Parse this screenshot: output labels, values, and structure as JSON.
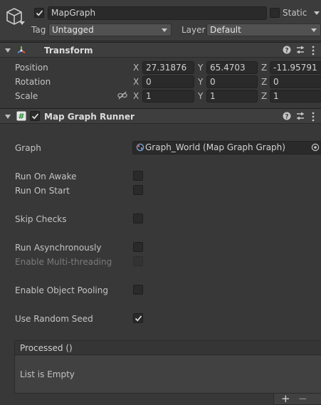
{
  "header": {
    "active": true,
    "object_name": "MapGraph",
    "static_label": "Static",
    "tag_label": "Tag",
    "tag_value": "Untagged",
    "layer_label": "Layer",
    "layer_value": "Default"
  },
  "transform": {
    "title": "Transform",
    "position": {
      "label": "Position",
      "x": "27.31876",
      "y": "65.4703",
      "z": "-11.95791"
    },
    "rotation": {
      "label": "Rotation",
      "x": "0",
      "y": "0",
      "z": "0"
    },
    "scale": {
      "label": "Scale",
      "x": "1",
      "y": "1",
      "z": "1"
    },
    "axis_labels": {
      "x": "X",
      "y": "Y",
      "z": "Z"
    }
  },
  "runner": {
    "enabled": true,
    "title": "Map Graph Runner",
    "graph_label": "Graph",
    "graph_value": "Graph_World (Map Graph Graph)",
    "options": {
      "run_on_awake": {
        "label": "Run On Awake",
        "checked": false
      },
      "run_on_start": {
        "label": "Run On Start",
        "checked": false
      },
      "skip_checks": {
        "label": "Skip Checks",
        "checked": false
      },
      "run_async": {
        "label": "Run Asynchronously",
        "checked": false
      },
      "multithreading": {
        "label": "Enable Multi-threading",
        "checked": false,
        "disabled": true
      },
      "object_pooling": {
        "label": "Enable Object Pooling",
        "checked": false
      },
      "random_seed": {
        "label": "Use Random Seed",
        "checked": true
      }
    },
    "event": {
      "title": "Processed ()",
      "empty_text": "List is Empty",
      "add_label": "+",
      "remove_label": "−"
    }
  },
  "colors": {
    "background": "#383838",
    "header": "#3e3e3e",
    "field": "#2a2a2a",
    "text": "#c4c4c4"
  }
}
